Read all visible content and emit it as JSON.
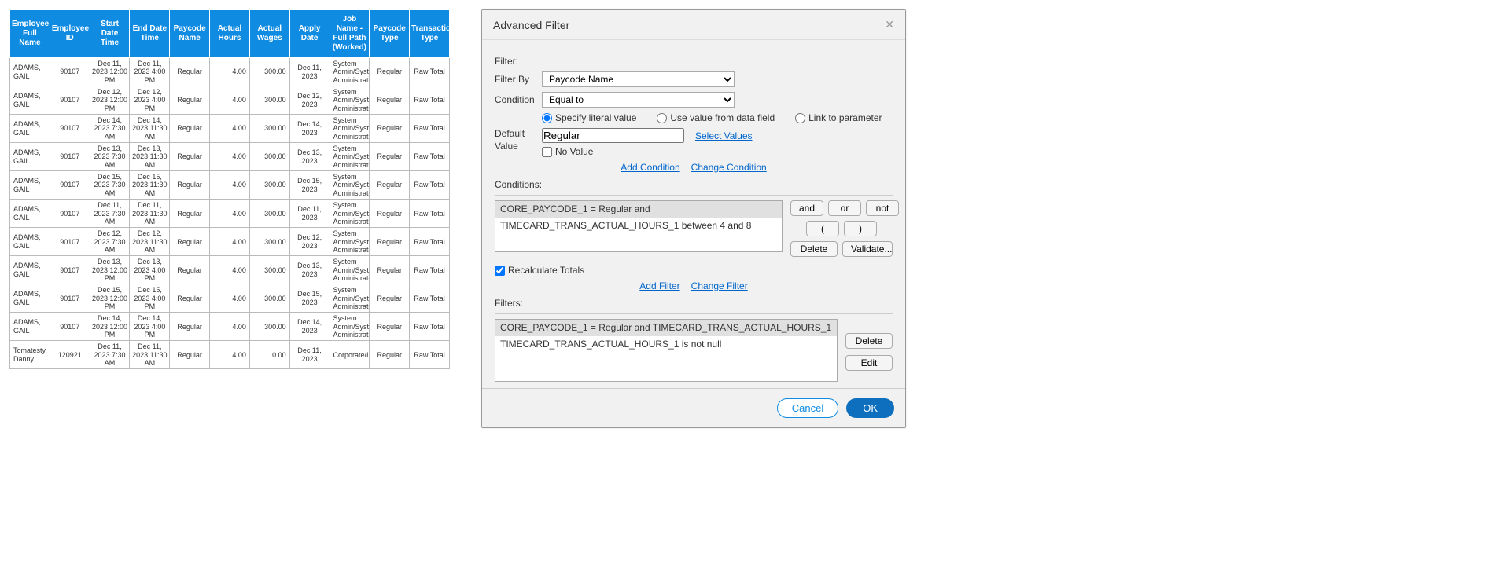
{
  "table": {
    "headers": [
      "Employee Full Name",
      "Employee ID",
      "Start Date Time",
      "End Date Time",
      "Paycode Name",
      "Actual Hours",
      "Actual Wages",
      "Apply Date",
      "Job Name - Full Path (Worked)",
      "Paycode Type",
      "Transaction Type"
    ],
    "rows": [
      {
        "name": "ADAMS, GAIL",
        "id": "90107",
        "start": "Dec 11, 2023 12:00 PM",
        "end": "Dec 11, 2023 4:00 PM",
        "paycode": "Regular",
        "hours": "4.00",
        "wages": "300.00",
        "apply": "Dec 11, 2023",
        "job": "System Admin/System Administrator",
        "ptype": "Regular",
        "ttype": "Raw Total"
      },
      {
        "name": "ADAMS, GAIL",
        "id": "90107",
        "start": "Dec 12, 2023 12:00 PM",
        "end": "Dec 12, 2023 4:00 PM",
        "paycode": "Regular",
        "hours": "4.00",
        "wages": "300.00",
        "apply": "Dec 12, 2023",
        "job": "System Admin/System Administrator",
        "ptype": "Regular",
        "ttype": "Raw Total"
      },
      {
        "name": "ADAMS, GAIL",
        "id": "90107",
        "start": "Dec 14, 2023 7:30 AM",
        "end": "Dec 14, 2023 11:30 AM",
        "paycode": "Regular",
        "hours": "4.00",
        "wages": "300.00",
        "apply": "Dec 14, 2023",
        "job": "System Admin/System Administrator",
        "ptype": "Regular",
        "ttype": "Raw Total"
      },
      {
        "name": "ADAMS, GAIL",
        "id": "90107",
        "start": "Dec 13, 2023 7:30 AM",
        "end": "Dec 13, 2023 11:30 AM",
        "paycode": "Regular",
        "hours": "4.00",
        "wages": "300.00",
        "apply": "Dec 13, 2023",
        "job": "System Admin/System Administrator",
        "ptype": "Regular",
        "ttype": "Raw Total"
      },
      {
        "name": "ADAMS, GAIL",
        "id": "90107",
        "start": "Dec 15, 2023 7:30 AM",
        "end": "Dec 15, 2023 11:30 AM",
        "paycode": "Regular",
        "hours": "4.00",
        "wages": "300.00",
        "apply": "Dec 15, 2023",
        "job": "System Admin/System Administrator",
        "ptype": "Regular",
        "ttype": "Raw Total"
      },
      {
        "name": "ADAMS, GAIL",
        "id": "90107",
        "start": "Dec 11, 2023 7:30 AM",
        "end": "Dec 11, 2023 11:30 AM",
        "paycode": "Regular",
        "hours": "4.00",
        "wages": "300.00",
        "apply": "Dec 11, 2023",
        "job": "System Admin/System Administrator",
        "ptype": "Regular",
        "ttype": "Raw Total"
      },
      {
        "name": "ADAMS, GAIL",
        "id": "90107",
        "start": "Dec 12, 2023 7:30 AM",
        "end": "Dec 12, 2023 11:30 AM",
        "paycode": "Regular",
        "hours": "4.00",
        "wages": "300.00",
        "apply": "Dec 12, 2023",
        "job": "System Admin/System Administrator",
        "ptype": "Regular",
        "ttype": "Raw Total"
      },
      {
        "name": "ADAMS, GAIL",
        "id": "90107",
        "start": "Dec 13, 2023 12:00 PM",
        "end": "Dec 13, 2023 4:00 PM",
        "paycode": "Regular",
        "hours": "4.00",
        "wages": "300.00",
        "apply": "Dec 13, 2023",
        "job": "System Admin/System Administrator",
        "ptype": "Regular",
        "ttype": "Raw Total"
      },
      {
        "name": "ADAMS, GAIL",
        "id": "90107",
        "start": "Dec 15, 2023 12:00 PM",
        "end": "Dec 15, 2023 4:00 PM",
        "paycode": "Regular",
        "hours": "4.00",
        "wages": "300.00",
        "apply": "Dec 15, 2023",
        "job": "System Admin/System Administrator",
        "ptype": "Regular",
        "ttype": "Raw Total"
      },
      {
        "name": "ADAMS, GAIL",
        "id": "90107",
        "start": "Dec 14, 2023 12:00 PM",
        "end": "Dec 14, 2023 4:00 PM",
        "paycode": "Regular",
        "hours": "4.00",
        "wages": "300.00",
        "apply": "Dec 14, 2023",
        "job": "System Admin/System Administrator",
        "ptype": "Regular",
        "ttype": "Raw Total"
      },
      {
        "name": "Tomatesty, Danny",
        "id": "120921",
        "start": "Dec 11, 2023 7:30 AM",
        "end": "Dec 11, 2023 11:30 AM",
        "paycode": "Regular",
        "hours": "4.00",
        "wages": "0.00",
        "apply": "Dec 11, 2023",
        "job": "Corporate/IS",
        "ptype": "Regular",
        "ttype": "Raw Total"
      }
    ]
  },
  "dialog": {
    "title": "Advanced Filter",
    "filter_section": "Filter:",
    "filter_by_label": "Filter By",
    "filter_by_value": "Paycode Name",
    "condition_label": "Condition",
    "condition_value": "Equal to",
    "radio_literal": "Specify literal value",
    "radio_datafield": "Use value from data field",
    "radio_link": "Link to parameter",
    "default_value_label1": "Default",
    "default_value_label2": "Value",
    "default_value": "Regular",
    "select_values": "Select Values",
    "no_value": "No Value",
    "add_condition": "Add Condition",
    "change_condition": "Change Condition",
    "conditions_section": "Conditions:",
    "cond_line1": "CORE_PAYCODE_1 = Regular and",
    "cond_line2": "TIMECARD_TRANS_ACTUAL_HOURS_1 between 4 and 8",
    "btn_and": "and",
    "btn_or": "or",
    "btn_not": "not",
    "btn_lp": "(",
    "btn_rp": ")",
    "btn_delete": "Delete",
    "btn_validate": "Validate...",
    "recalc": "Recalculate Totals",
    "add_filter": "Add Filter",
    "change_filter": "Change Filter",
    "filters_section": "Filters:",
    "filter_line1": "CORE_PAYCODE_1 = Regular and TIMECARD_TRANS_ACTUAL_HOURS_1",
    "filter_line2": "TIMECARD_TRANS_ACTUAL_HOURS_1 is not null",
    "btn_edit": "Edit",
    "cancel": "Cancel",
    "ok": "OK"
  }
}
